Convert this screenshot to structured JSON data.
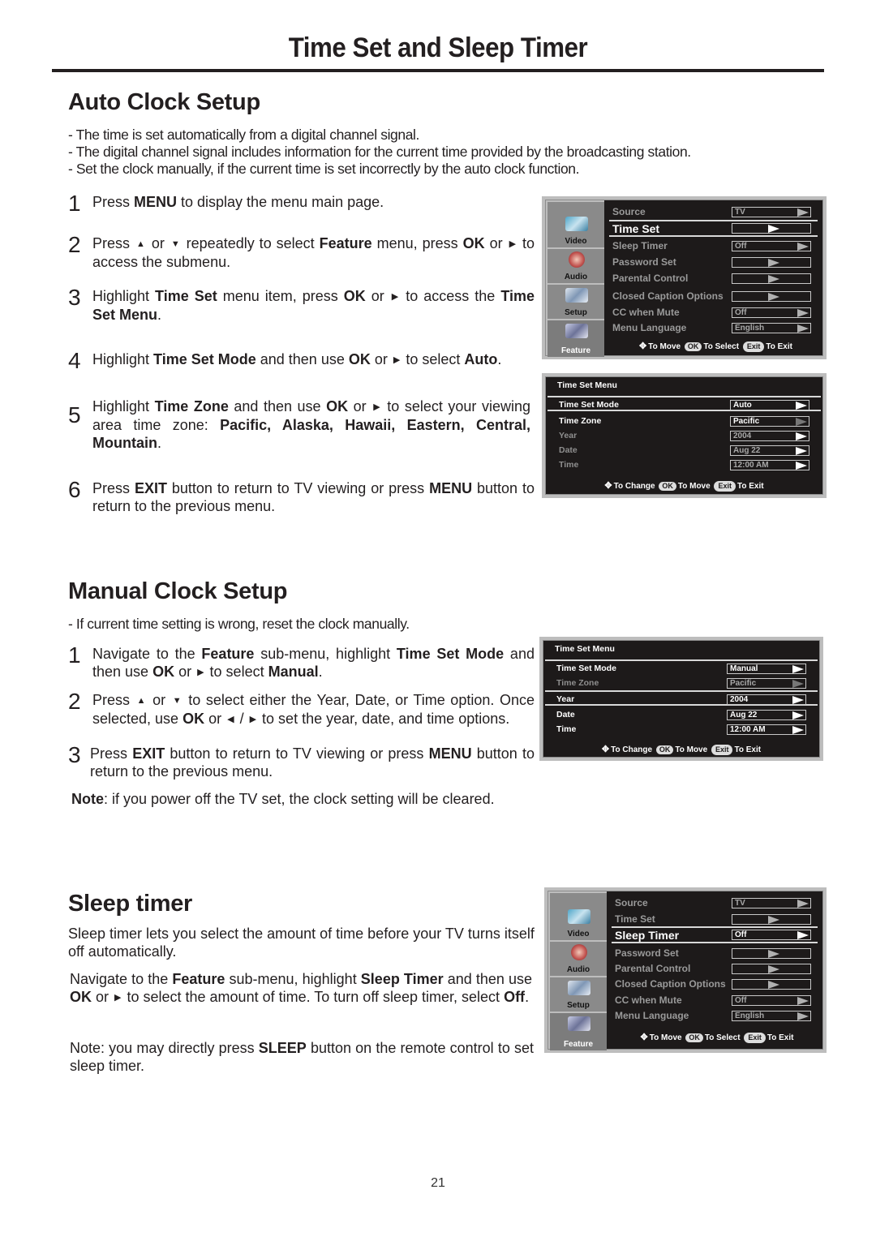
{
  "page": {
    "title": "Time Set and Sleep Timer",
    "page_number": "21"
  },
  "auto": {
    "heading": "Auto Clock Setup",
    "bullets": [
      "- The time is set automatically from a digital channel signal.",
      "- The digital channel signal includes information for the current time provided by the broadcasting station.",
      "- Set the clock manually, if the current time is set incorrectly by the auto clock function."
    ],
    "steps": [
      {
        "num": "1",
        "parts": [
          [
            "Press  ",
            0
          ],
          [
            "MENU",
            1
          ],
          [
            " to display the menu main page.",
            0
          ]
        ]
      },
      {
        "num": "2",
        "parts": [
          [
            "Press ",
            0
          ],
          [
            "▲",
            2
          ],
          [
            " or ",
            0
          ],
          [
            "▼",
            2
          ],
          [
            " repeatedly to select ",
            0
          ],
          [
            "Feature",
            1
          ],
          [
            " menu, press ",
            0
          ],
          [
            "OK",
            1
          ],
          [
            " or ",
            0
          ],
          [
            "▶",
            2
          ],
          [
            " to access the submenu.",
            0
          ]
        ]
      },
      {
        "num": "3",
        "parts": [
          [
            "Highlight ",
            0
          ],
          [
            "Time Set",
            1
          ],
          [
            " menu item, press ",
            0
          ],
          [
            "OK",
            1
          ],
          [
            " or ",
            0
          ],
          [
            "▶",
            2
          ],
          [
            " to access the ",
            0
          ],
          [
            "Time Set Menu",
            1
          ],
          [
            ".",
            0
          ]
        ]
      },
      {
        "num": "4",
        "parts": [
          [
            "Highlight ",
            0
          ],
          [
            "Time Set Mode",
            1
          ],
          [
            " and then use ",
            0
          ],
          [
            "OK",
            1
          ],
          [
            " or ",
            0
          ],
          [
            "▶",
            2
          ],
          [
            " to select ",
            0
          ],
          [
            "Auto",
            1
          ],
          [
            ".",
            0
          ]
        ]
      },
      {
        "num": "5",
        "parts": [
          [
            "Highlight ",
            0
          ],
          [
            "Time Zone",
            1
          ],
          [
            " and then use ",
            0
          ],
          [
            "OK",
            1
          ],
          [
            " or ",
            0
          ],
          [
            "▶",
            2
          ],
          [
            " to select your viewing area time zone: ",
            0
          ],
          [
            "Pacific, Alaska, Hawaii, Eastern, Central, Mountain",
            1
          ],
          [
            ".",
            0
          ]
        ]
      },
      {
        "num": "6",
        "parts": [
          [
            "Press ",
            0
          ],
          [
            "EXIT",
            1
          ],
          [
            " button to return to TV viewing or press ",
            0
          ],
          [
            "MENU",
            1
          ],
          [
            " button to return to the previous menu.",
            0
          ]
        ]
      }
    ]
  },
  "manual": {
    "heading": "Manual Clock Setup",
    "bullet": "- If current time setting is wrong, reset the clock manually.",
    "steps": [
      {
        "num": "1",
        "parts": [
          [
            "Navigate to the ",
            0
          ],
          [
            "Feature",
            1
          ],
          [
            " sub-menu,  highlight ",
            0
          ],
          [
            "Time Set Mode",
            1
          ],
          [
            " and then use ",
            0
          ],
          [
            "OK",
            1
          ],
          [
            " or ",
            0
          ],
          [
            "▶",
            2
          ],
          [
            " to select ",
            0
          ],
          [
            "Manual",
            1
          ],
          [
            ".",
            0
          ]
        ]
      },
      {
        "num": "2",
        "parts": [
          [
            "Press ",
            0
          ],
          [
            "▲",
            2
          ],
          [
            " or ",
            0
          ],
          [
            "▼",
            2
          ],
          [
            " to select either the Year, Date, or Time option. Once selected, use ",
            0
          ],
          [
            "OK",
            1
          ],
          [
            " or ",
            0
          ],
          [
            "◀",
            2
          ],
          [
            " / ",
            0
          ],
          [
            "▶",
            2
          ],
          [
            " to set the year, date, and time options.",
            0
          ]
        ]
      },
      {
        "num": "3",
        "parts": [
          [
            "Press ",
            0
          ],
          [
            "EXIT",
            1
          ],
          [
            " button to return to TV viewing or press ",
            0
          ],
          [
            "MENU",
            1
          ],
          [
            " button to return to the previous menu.",
            0
          ]
        ]
      }
    ],
    "note_label": "Note",
    "note_text": ": if you power off the TV set, the clock setting will be cleared."
  },
  "sleep": {
    "heading": "Sleep timer",
    "intro": "Sleep timer lets you select the amount of time before your TV turns itself off automatically.",
    "instruction": [
      [
        "Navigate to the ",
        0
      ],
      [
        "Feature",
        1
      ],
      [
        " sub-menu, highlight ",
        0
      ],
      [
        "Sleep Timer",
        1
      ],
      [
        " and then use ",
        0
      ],
      [
        "OK",
        1
      ],
      [
        " or ",
        0
      ],
      [
        "▶",
        2
      ],
      [
        " to select the amount of time. To turn off sleep timer, select ",
        0
      ],
      [
        "Off",
        1
      ],
      [
        ".",
        0
      ]
    ],
    "note": [
      [
        "Note: you may directly press ",
        0
      ],
      [
        "SLEEP",
        1
      ],
      [
        " button on the remote control to set sleep timer.",
        0
      ]
    ]
  },
  "osd_feature_menu": {
    "side_tabs": [
      {
        "label": "Video",
        "icon": "video-icon"
      },
      {
        "label": "Audio",
        "icon": "audio-icon"
      },
      {
        "label": "Setup",
        "icon": "setup-icon"
      },
      {
        "label": "Feature",
        "icon": "feature-icon"
      }
    ],
    "active_tab": "Feature",
    "items": [
      {
        "label": "Source",
        "value": "TV"
      },
      {
        "label": "Time Set",
        "value": ""
      },
      {
        "label": "Sleep Timer",
        "value": "Off"
      },
      {
        "label": "Password Set",
        "value": ""
      },
      {
        "label": "Parental Control",
        "value": ""
      },
      {
        "label": "Closed Caption Options",
        "value": ""
      },
      {
        "label": "CC when Mute",
        "value": "Off"
      },
      {
        "label": "Menu Language",
        "value": "English"
      }
    ],
    "hint": {
      "move": "To Move",
      "ok": "OK",
      "select": "To Select",
      "exit_key": "Exit",
      "exit": "To Exit"
    }
  },
  "osd_time_auto": {
    "title": "Time Set Menu",
    "items": [
      {
        "label": "Time Set Mode",
        "value": "Auto"
      },
      {
        "label": "Time Zone",
        "value": "Pacific"
      },
      {
        "label": "Year",
        "value": "2004"
      },
      {
        "label": "Date",
        "value": "Aug 22"
      },
      {
        "label": "Time",
        "value": "12:00  AM"
      }
    ],
    "hint": {
      "change": "To Change",
      "ok": "OK",
      "move": "To Move",
      "exit_key": "Exit",
      "exit": "To Exit"
    }
  },
  "osd_time_manual": {
    "title": "Time Set Menu",
    "items": [
      {
        "label": "Time Set Mode",
        "value": "Manual"
      },
      {
        "label": "Time Zone",
        "value": "Pacific"
      },
      {
        "label": "Year",
        "value": "2004"
      },
      {
        "label": "Date",
        "value": "Aug 22"
      },
      {
        "label": "Time",
        "value": "12:00  AM"
      }
    ],
    "hint": {
      "change": "To Change",
      "ok": "OK",
      "move": "To Move",
      "exit_key": "Exit",
      "exit": "To Exit"
    }
  }
}
